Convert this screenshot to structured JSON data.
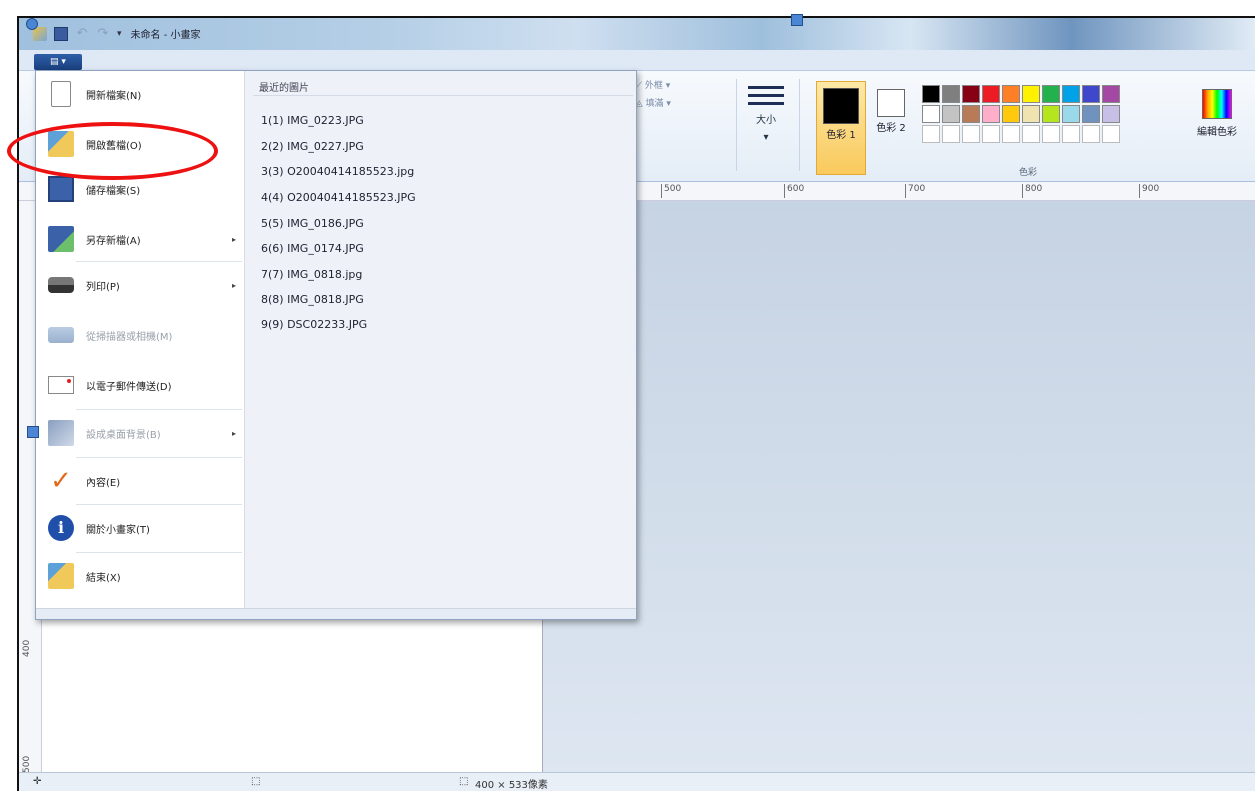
{
  "window": {
    "title": "未命名 - 小畫家",
    "menu_button_label": "▤ ▾"
  },
  "ribbon": {
    "outline_label": "外框",
    "fill_label": "填滿",
    "size_label": "大小",
    "color1_label": "色彩 1",
    "color2_label": "色彩 2",
    "colors_group_label": "色彩",
    "edit_colors_label": "編輯色彩",
    "palette": [
      "#000000",
      "#7f7f7f",
      "#880015",
      "#ed1c24",
      "#ff7f27",
      "#fff200",
      "#22b14c",
      "#00a2e8",
      "#3f48cc",
      "#a349a4",
      "#ffffff",
      "#c3c3c3",
      "#b97a57",
      "#ffaec9",
      "#ffc90e",
      "#efe4b0",
      "#b5e61d",
      "#99d9ea",
      "#7092be",
      "#c8bfe7"
    ]
  },
  "ruler": {
    "h_ticks": [
      "500",
      "600",
      "700",
      "800",
      "900"
    ],
    "v_ticks": [
      "400",
      "500"
    ]
  },
  "file_menu": {
    "items": [
      {
        "label": "開新檔案(N)",
        "icon": "new-file-icon"
      },
      {
        "label": "開啟舊檔(O)",
        "icon": "open-folder-icon"
      },
      {
        "label": "儲存檔案(S)",
        "icon": "save-icon"
      },
      {
        "label": "另存新檔(A)",
        "icon": "save-as-icon"
      },
      {
        "label": "列印(P)",
        "icon": "printer-icon"
      },
      {
        "label": "從掃描器或相機(M)",
        "icon": "scanner-icon"
      },
      {
        "label": "以電子郵件傳送(D)",
        "icon": "email-icon"
      },
      {
        "label": "設成桌面背景(B)",
        "icon": "desktop-background-icon"
      },
      {
        "label": "內容(E)",
        "icon": "properties-icon"
      },
      {
        "label": "關於小畫家(T)",
        "icon": "info-icon"
      },
      {
        "label": "結束(X)",
        "icon": "exit-icon"
      }
    ],
    "recent_header": "最近的圖片",
    "recent": [
      "1(1) IMG_0223.JPG",
      "2(2) IMG_0227.JPG",
      "3(3) O20040414185523.jpg",
      "4(4) O20040414185523.JPG",
      "5(5) IMG_0186.JPG",
      "6(6) IMG_0174.JPG",
      "7(7) IMG_0818.jpg",
      "8(8) IMG_0818.JPG",
      "9(9) DSC02233.JPG"
    ]
  },
  "status": {
    "image_size": "400 × 533像素"
  }
}
